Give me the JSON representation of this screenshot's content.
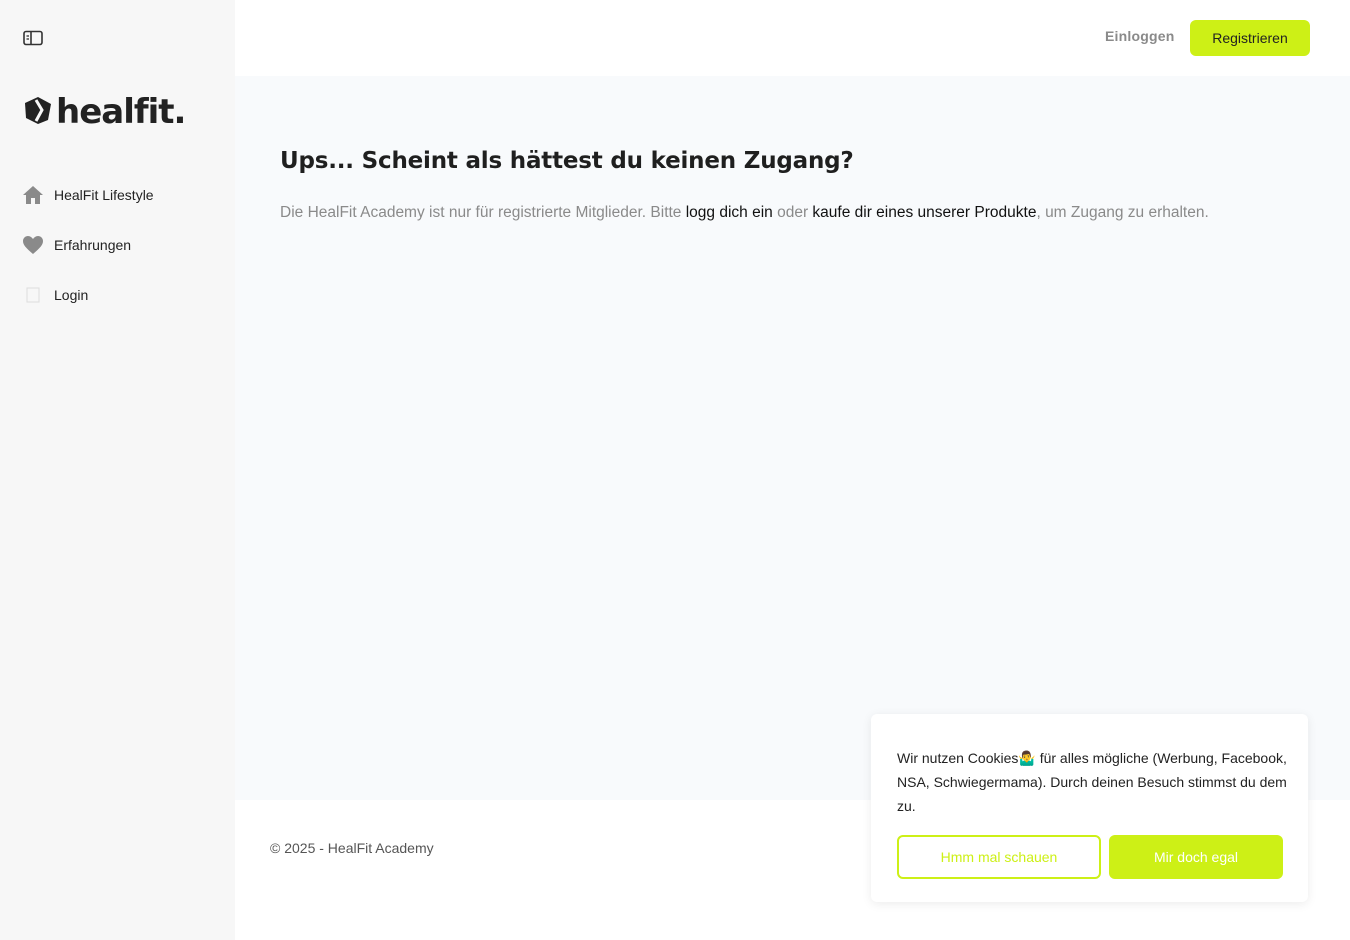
{
  "sidebar": {
    "logo_text": "healfit.",
    "items": [
      {
        "label": "HealFit Lifestyle",
        "icon": "home-icon"
      },
      {
        "label": "Erfahrungen",
        "icon": "heart-icon"
      },
      {
        "label": "Login",
        "icon": "login-icon"
      }
    ]
  },
  "header": {
    "login_label": "Einloggen",
    "register_label": "Registrieren"
  },
  "main": {
    "title": "Ups... Scheint als hättest du keinen Zugang?",
    "text_part1": "Die HealFit Academy ist nur für registrierte Mitglieder. Bitte ",
    "link_login": "logg dich ein",
    "text_part2": " oder ",
    "link_products": "kaufe dir eines unserer Produkte",
    "text_part3": ", um Zugang zu erhalten."
  },
  "footer": {
    "copyright": "© 2025 - HealFit Academy"
  },
  "cookie_banner": {
    "text": "Wir nutzen Cookies🤷‍♂️ für alles mögliche (Werbung, Facebook, NSA, Schwiegermama). Durch deinen Besuch stimmst du dem zu.",
    "secondary_label": "Hmm mal schauen",
    "primary_label": "Mir doch egal"
  },
  "colors": {
    "accent": "#cdf016",
    "sidebar_bg": "#f7f7f7",
    "content_bg": "#f8fafc"
  }
}
